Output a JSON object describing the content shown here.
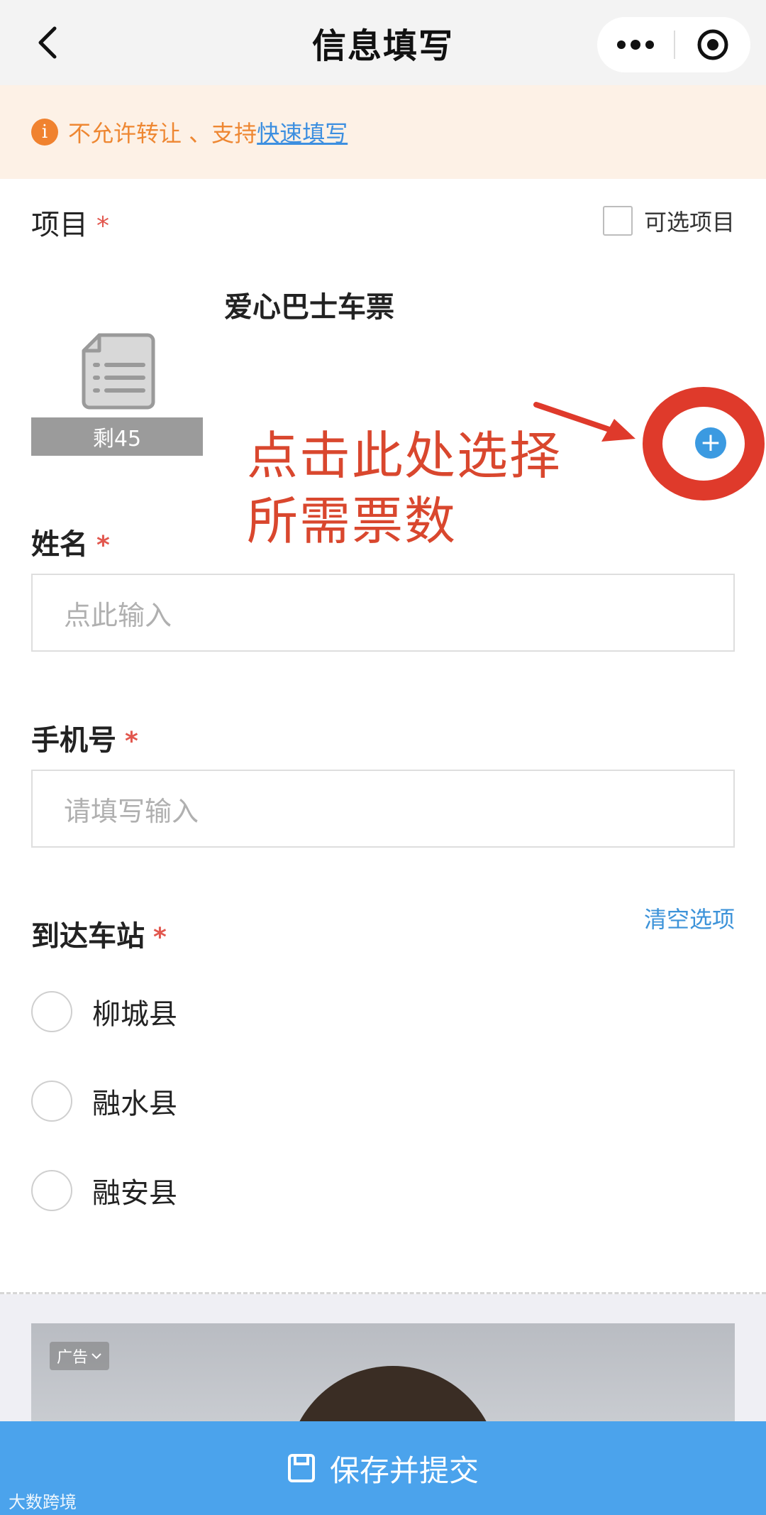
{
  "header": {
    "title": "信息填写"
  },
  "notice": {
    "text": "不允许转让 、支持",
    "link": "快速填写"
  },
  "project": {
    "label": "项目",
    "required_mark": "*",
    "optional_label": "可选项目",
    "item_title": "爱心巴士车票",
    "remaining": "剩45",
    "add_symbol": "+"
  },
  "annotation": {
    "line1": "点击此处选择",
    "line2": "所需票数"
  },
  "name_field": {
    "label": "姓名",
    "required_mark": "*",
    "placeholder": "点此输入"
  },
  "phone_field": {
    "label": "手机号",
    "required_mark": "*",
    "placeholder": "请填写输入"
  },
  "station_field": {
    "label": "到达车站",
    "required_mark": "*",
    "clear_label": "清空选项",
    "options": [
      "柳城县",
      "融水县",
      "融安县"
    ]
  },
  "ad": {
    "badge": "广告"
  },
  "submit": {
    "label": "保存并提交"
  },
  "watermark": "大数跨境",
  "colors": {
    "accent": "#4ba3ec",
    "warning": "#ee8732",
    "required": "#e2574e",
    "annotation": "#d9472e"
  }
}
